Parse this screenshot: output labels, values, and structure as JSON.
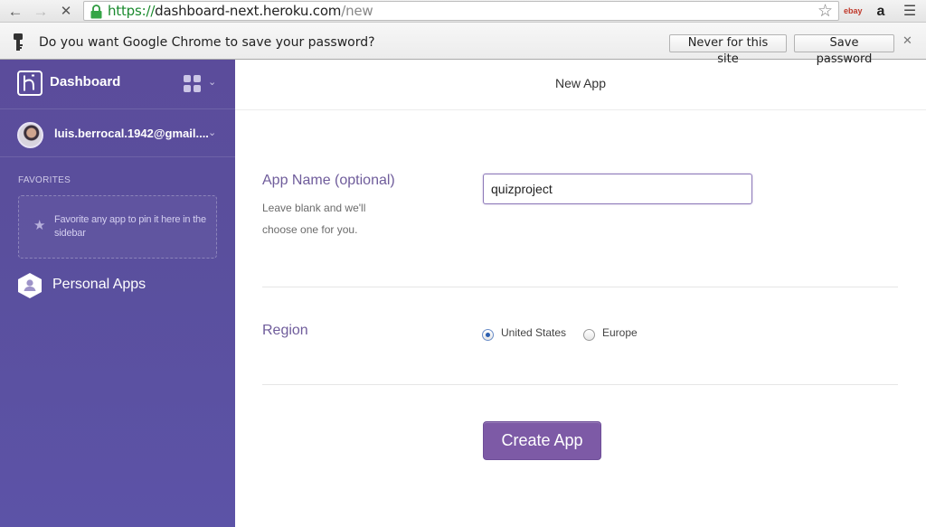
{
  "browser": {
    "url_scheme": "https://",
    "url_host": "dashboard-next.heroku.com",
    "url_path": "/new",
    "back_glyph": "←",
    "forward_glyph": "→",
    "stop_glyph": "✕",
    "star_glyph": "☆",
    "extensions": {
      "ebay": "ebay",
      "amazon": "a"
    },
    "menu_glyph": "☰"
  },
  "infobar": {
    "message": "Do you want Google Chrome to save your password?",
    "never_label": "Never for this site",
    "save_label": "Save password",
    "close_glyph": "✕"
  },
  "sidebar": {
    "brand": "Dashboard",
    "account": "luis.berrocal.1942@gmail....",
    "favorites_title": "FAVORITES",
    "favorites_hint": "Favorite any app to pin it here in the sidebar",
    "personal_apps": "Personal Apps",
    "caret": "⌄"
  },
  "main": {
    "title": "New App",
    "app_name_label": "App Name (optional)",
    "app_name_help": "Leave blank and we'll choose one for you.",
    "app_name_value": "quizproject",
    "region_label": "Region",
    "region_options": [
      "United States",
      "Europe"
    ],
    "region_selected": "United States",
    "create_label": "Create App"
  },
  "colors": {
    "sidebar": "#5a4f9d",
    "accent": "#7d5aa6",
    "field_title": "#6f5c9b"
  }
}
